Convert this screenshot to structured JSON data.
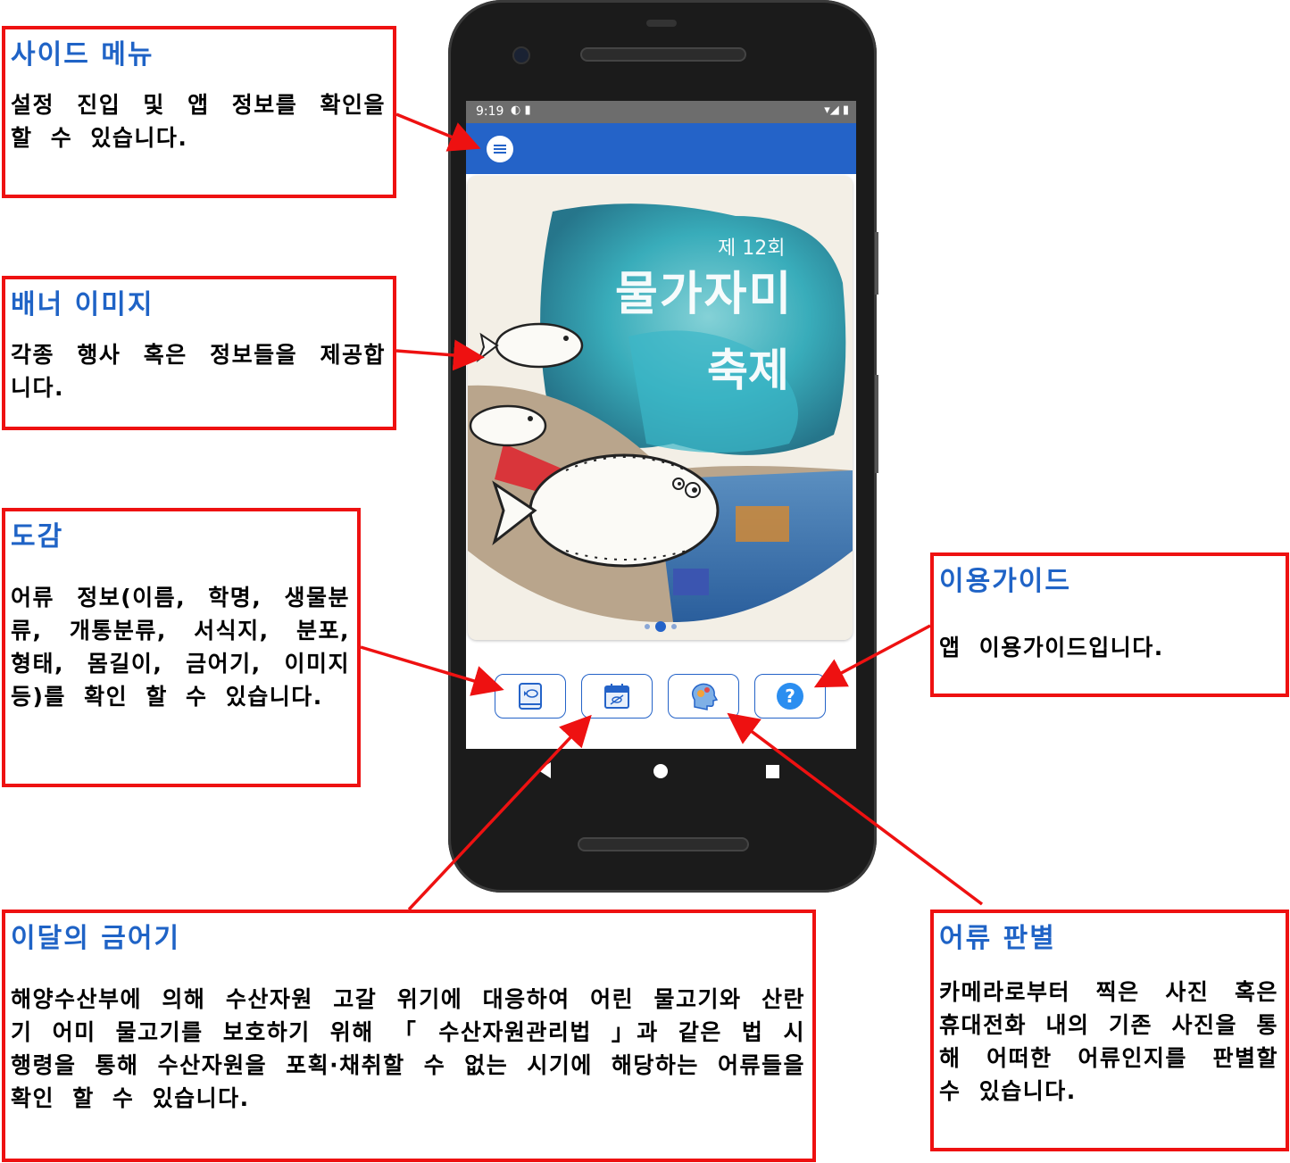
{
  "phone": {
    "status_time": "9:19",
    "banner": {
      "edition": "제 12회",
      "title_line1": "물가자미",
      "title_line2": "축제"
    },
    "carousel": {
      "count": 3,
      "active": 2
    }
  },
  "notes": {
    "side_menu": {
      "title": "사이드 메뉴",
      "body": "설정 진입 및 앱 정보를 확인을 할 수 있습니다."
    },
    "banner": {
      "title": "배너 이미지",
      "body": "각종 행사 혹은 정보들을 제공합니다."
    },
    "dogam": {
      "title": "도감",
      "body": "어류 정보(이름, 학명, 생물분류, 개통분류, 서식지, 분포, 형태, 몸길이, 금어기, 이미지 등)를 확인 할 수 있습니다."
    },
    "guide": {
      "title": "이용가이드",
      "body": "앱 이용가이드입니다."
    },
    "monthly_ban": {
      "title": "이달의 금어기",
      "body": "해양수산부에 의해 수산자원 고갈 위기에 대응하여 어린 물고기와 산란기 어미 물고기를 보호하기 위해 「 수산자원관리법 」과 같은 법 시행령을 통해 수산자원을 포획·채취할 수 없는 시기에 해당하는 어류들을 확인 할 수 있습니다."
    },
    "fish_identify": {
      "title": "어류 판별",
      "body": "카메라로부터 찍은 사진 혹은 휴대전화 내의 기존 사진을 통해 어떠한 어류인지를 판별할 수 있습니다."
    }
  },
  "colors": {
    "annotation_border": "#ee1111",
    "title_blue": "#1f63c6",
    "app_blue": "#2463c8",
    "arrow": "#ee1111"
  },
  "icons": [
    "menu-icon",
    "fish-book-icon",
    "calendar-icon",
    "brain-gear-icon",
    "help-icon"
  ]
}
